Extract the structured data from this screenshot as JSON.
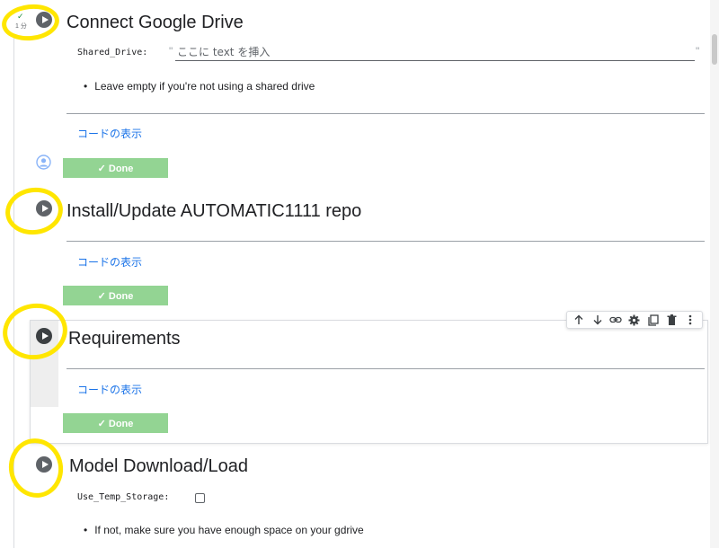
{
  "cells": [
    {
      "title": "Connect Google Drive",
      "exec_time": "1 分",
      "param_label": "Shared_Drive:",
      "input_placeholder": "ここに text を挿入",
      "quote_open": "\"",
      "quote_close": "\"",
      "bullet": "Leave empty if you're not using a shared drive",
      "code_link": "コードの表示",
      "status": "✓ Done"
    },
    {
      "title": "Install/Update AUTOMATIC1111 repo",
      "code_link": "コードの表示",
      "status": "✓ Done"
    },
    {
      "title": "Requirements",
      "code_link": "コードの表示",
      "status": "✓ Done"
    },
    {
      "title": "Model Download/Load",
      "param_label": "Use_Temp_Storage:",
      "checkbox_checked": false,
      "bullet": "If not, make sure you have enough space on your gdrive"
    }
  ],
  "toolbar": {
    "icons": [
      "arrow-up-icon",
      "arrow-down-icon",
      "link-icon",
      "gear-icon",
      "mirror-cell-icon",
      "delete-icon",
      "more-vert-icon"
    ]
  },
  "colors": {
    "highlight_circle": "#ffe600",
    "done_bar": "#93d493",
    "link": "#1a73e8"
  }
}
